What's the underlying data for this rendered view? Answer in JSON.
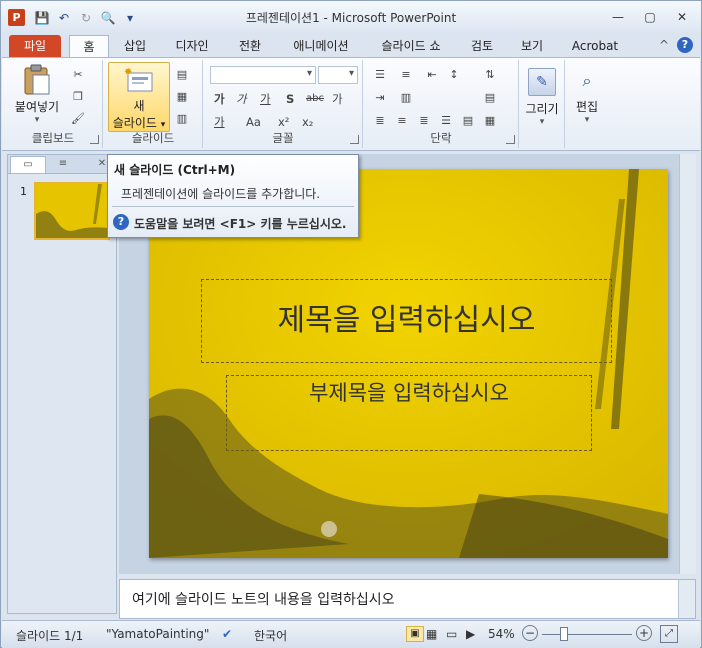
{
  "window": {
    "title": "프레젠테이션1 - Microsoft PowerPoint",
    "app_letter": "P",
    "controls": {
      "minimize": "—",
      "maximize": "▢",
      "close": "✕"
    }
  },
  "qat": {
    "save": "💾",
    "undo": "↶",
    "redo": "↻",
    "print_preview": "🔍",
    "customize": "▾"
  },
  "tabs": [
    {
      "label": "파일"
    },
    {
      "label": "홈"
    },
    {
      "label": "삽입"
    },
    {
      "label": "디자인"
    },
    {
      "label": "전환"
    },
    {
      "label": "애니메이션"
    },
    {
      "label": "슬라이드 쇼"
    },
    {
      "label": "검토"
    },
    {
      "label": "보기"
    },
    {
      "label": "Acrobat"
    }
  ],
  "ribbon_right": {
    "collapse": "^",
    "help": "?"
  },
  "ribbon": {
    "clipboard": {
      "label": "클립보드",
      "paste": "붙여넣기"
    },
    "slides": {
      "label": "슬라이드",
      "new_slide_1": "새",
      "new_slide_2": "슬라이드"
    },
    "font": {
      "label": "글꼴",
      "ga1": "가",
      "ga2": "가",
      "ga3": "가",
      "ga4": "가",
      "aa": "Aa",
      "s": "S",
      "abc": "abc",
      "ga5": "가"
    },
    "paragraph": {
      "label": "단락"
    },
    "drawing": {
      "label": "그리기"
    },
    "editing": {
      "label": "편집"
    }
  },
  "tooltip": {
    "title": "새 슬라이드 (Ctrl+M)",
    "desc": "프레젠테이션에 슬라이드를 추가합니다.",
    "help": "도움말을 보려면 <F1> 키를 누르십시오."
  },
  "panel": {
    "thumb_number": "1"
  },
  "slide": {
    "title_placeholder": "제목을 입력하십시오",
    "subtitle_placeholder": "부제목을 입력하십시오"
  },
  "notes": {
    "text": "여기에 슬라이드 노트의 내용을 입력하십시오"
  },
  "status": {
    "slide": "슬라이드 1/1",
    "theme": "\"YamatoPainting\"",
    "language": "한국어",
    "zoom": "54%",
    "zoom_minus": "−",
    "zoom_plus": "+"
  },
  "colors": {
    "file_tab": "#d24726",
    "slide_bg": "#e5c400",
    "accent": "#2f66c2"
  }
}
